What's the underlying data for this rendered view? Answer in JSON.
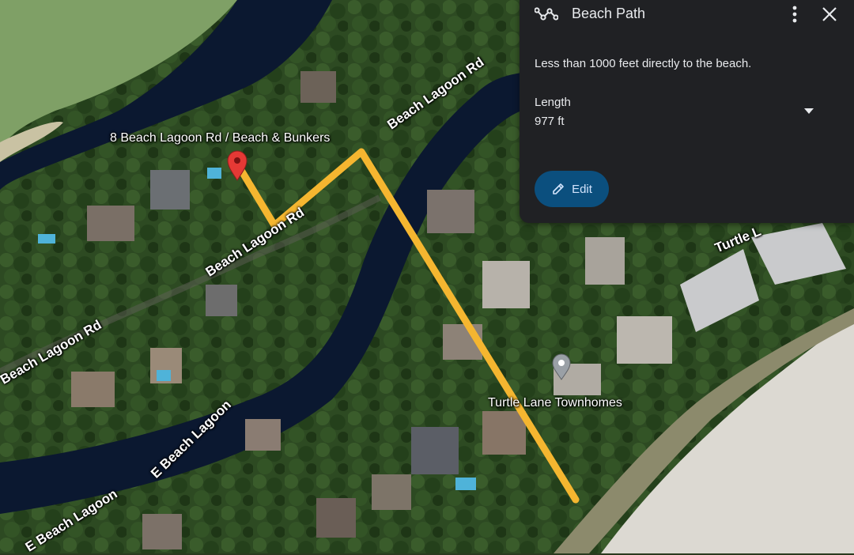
{
  "map": {
    "road_labels": [
      "Beach Lagoon Rd",
      "Beach Lagoon Rd",
      "Beach Lagoon Rd",
      "E Beach Lagoon",
      "E Beach Lagoon",
      "Turtle L"
    ],
    "place_labels": {
      "start_point": "8 Beach Lagoon Rd / Beach & Bunkers",
      "poi": "Turtle Lane Townhomes"
    },
    "path_color": "#f5b630",
    "pin_color": "#e53935"
  },
  "panel": {
    "icon": "path-icon",
    "title": "Beach Path",
    "more_icon": "more-vert-icon",
    "close_icon": "close-icon",
    "description": "Less than 1000 feet directly to the beach.",
    "length_label": "Length",
    "length_value": "977 ft",
    "expand_icon": "dropdown-arrow-icon",
    "edit_label": "Edit",
    "edit_icon": "pencil-icon",
    "edit_color": "#0b4f7e"
  }
}
